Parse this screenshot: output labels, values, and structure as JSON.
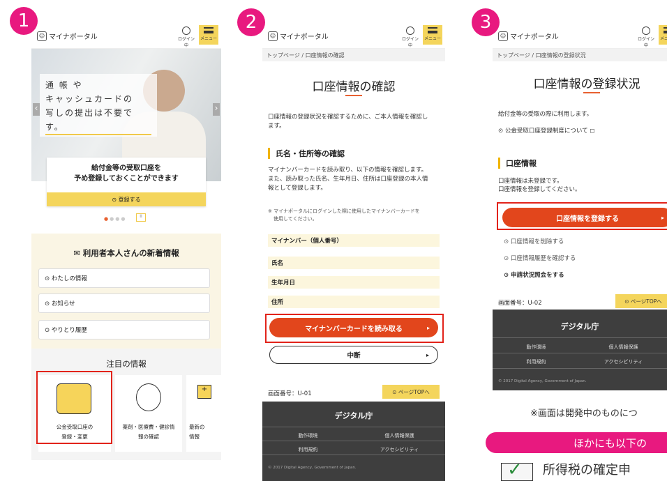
{
  "badges": [
    "1",
    "2",
    "3"
  ],
  "logo": "マイナポータル",
  "login_label": "ログイン中",
  "menu_label": "メニュー",
  "p1": {
    "hero_text": [
      "通 帳 や",
      "キャッシュカードの",
      "写しの提出は不要です。"
    ],
    "card_title1": "給付金等の受取口座を",
    "card_title2": "予め登録しておくことができます",
    "register": "⊙ 登録する",
    "pause": "II",
    "news_title": "✉ 利用者本人さんの新着情報",
    "news_items": [
      "⊙ わたしの情報",
      "⊙ お知らせ",
      "⊙ やりとり履歴"
    ],
    "focus_title": "注目の情報",
    "tile1a": "公金受取口座の",
    "tile1b": "登録・変更",
    "tile2a": "薬剤・医療費・健診情",
    "tile2b": "報の確認",
    "tile3a": "最新の",
    "tile3b": "情報"
  },
  "p2": {
    "crumb": "トップページ / 口座情報の確認",
    "title": "口座情報の確認",
    "intro1": "口座情報の登録状況を確認するために、ご本人情報を確認し",
    "intro2": "ます。",
    "sec": "氏名・住所等の確認",
    "desc1": "マイナンバーカードを読み取り、以下の情報を確認します。",
    "desc2": "また、読み取った氏名、生年月日、住所は口座登録の本人情",
    "desc3": "報として登録します。",
    "note1": "※ マイナポータルにログインした際に使用したマイナンバーカードを",
    "note2": "使用してください。",
    "fields": [
      "マイナンバー（個人番号）",
      "氏名",
      "生年月日",
      "住所"
    ],
    "read_btn": "マイナンバーカードを読み取る",
    "cancel_btn": "中断",
    "screen_no": "画面番号：U-01",
    "pagetop": "⊙ ページTOPへ",
    "agency": "デジタル庁",
    "links": [
      "動作環境",
      "個人情報保護",
      "利用規約",
      "アクセシビリティ"
    ],
    "copyright": "© 2017 Digital Agency, Government of Japan."
  },
  "p3": {
    "crumb": "トップページ / 口座情報の登録状況",
    "title": "口座情報の登録状況",
    "intro": "給付金等の受取の際に利用します。",
    "about": "⊙ 公金受取口座登録制度について ◻",
    "sec": "口座情報",
    "status1": "口座情報は未登録です。",
    "status2": "口座情報を登録してください。",
    "reg_btn": "口座情報を登録する",
    "links": [
      "⊙ 口座情報を削除する",
      "⊙ 口座情報履歴を確認する",
      "⊙ 申請状況照会をする"
    ],
    "screen_no": "画面番号：U-02",
    "pagetop": "⊙ ページTOPへ",
    "agency": "デジタル庁",
    "flinks": [
      "動作環境",
      "個人情報保護",
      "利用規約",
      "アクセシビリティ"
    ],
    "copyright": "© 2017 Digital Agency, Government of Japan."
  },
  "note": "※画面は開発中のものにつ",
  "pink": "ほかにも以下の",
  "last": "所得税の確定申"
}
